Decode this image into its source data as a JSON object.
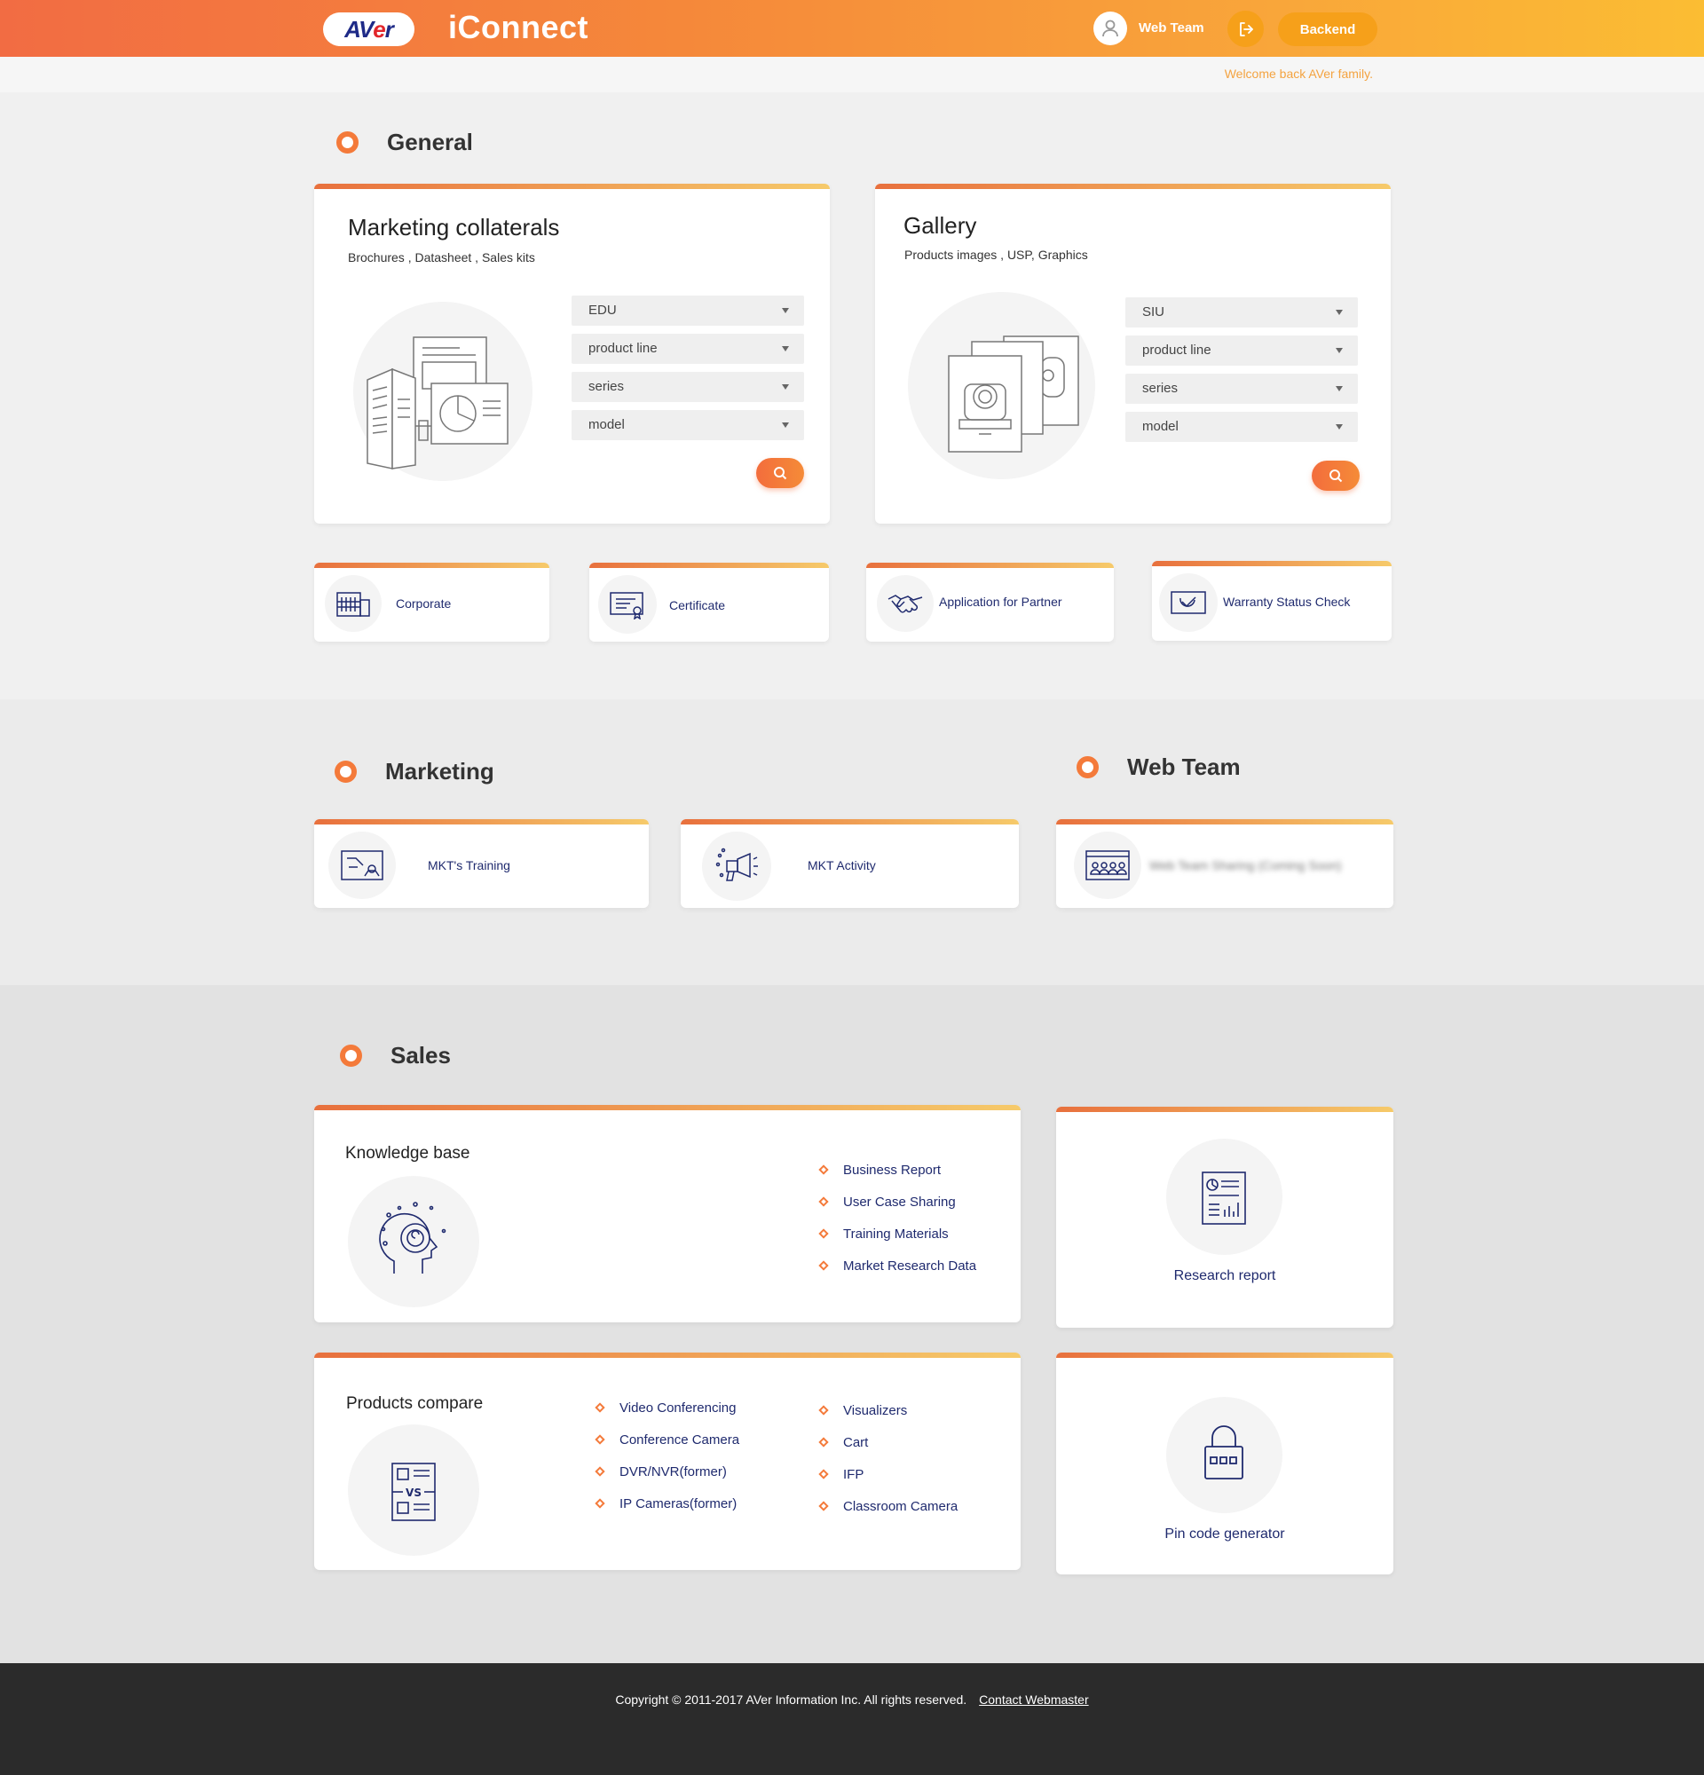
{
  "header": {
    "logo_main": "AV",
    "logo_e": "e",
    "logo_r": "r",
    "app_title": "iConnect",
    "user_name": "Web Team",
    "backend_label": "Backend",
    "welcome": "Welcome back AVer family."
  },
  "general": {
    "title": "General",
    "marketing_collaterals": {
      "title": "Marketing collaterals",
      "subtitle": "Brochures , Datasheet , Sales kits",
      "selects": [
        "EDU",
        "product line",
        "series",
        "model"
      ]
    },
    "gallery": {
      "title": "Gallery",
      "subtitle": "Products images , USP,  Graphics",
      "selects": [
        "SIU",
        "product line",
        "series",
        "model"
      ]
    },
    "links": [
      {
        "label": "Corporate",
        "icon": "building-icon"
      },
      {
        "label": "Certificate",
        "icon": "certificate-icon"
      },
      {
        "label": "Application for Partner",
        "icon": "handshake-icon"
      },
      {
        "label": "Warranty Status Check",
        "icon": "warranty-icon"
      }
    ]
  },
  "marketing": {
    "title": "Marketing",
    "links": [
      {
        "label": "MKT's Training",
        "icon": "training-icon"
      },
      {
        "label": "MKT Activity",
        "icon": "megaphone-icon"
      }
    ]
  },
  "webteam": {
    "title": "Web Team",
    "link": {
      "label": "Web Team Sharing (Coming Soon)",
      "icon": "meeting-icon"
    }
  },
  "sales": {
    "title": "Sales",
    "knowledge_base": {
      "title": "Knowledge base",
      "items": [
        "Business Report",
        "User Case Sharing",
        "Training Materials",
        "Market Research Data"
      ]
    },
    "research_report": {
      "label": "Research report"
    },
    "products_compare": {
      "title": "Products compare",
      "col1": [
        "Video Conferencing",
        "Conference Camera",
        "DVR/NVR(former)",
        "IP Cameras(former)"
      ],
      "col2": [
        "Visualizers",
        "Cart",
        "IFP",
        "Classroom Camera"
      ]
    },
    "pin_code": {
      "label": "Pin code generator"
    }
  },
  "footer": {
    "copyright": "Copyright © 2011-2017 AVer Information Inc. All rights reserved.",
    "contact": "Contact Webmaster"
  },
  "colors": {
    "accent": "#f47a3a",
    "brand_navy": "#1f2a6e",
    "header_start": "#f26c43",
    "header_end": "#fbbd33"
  }
}
